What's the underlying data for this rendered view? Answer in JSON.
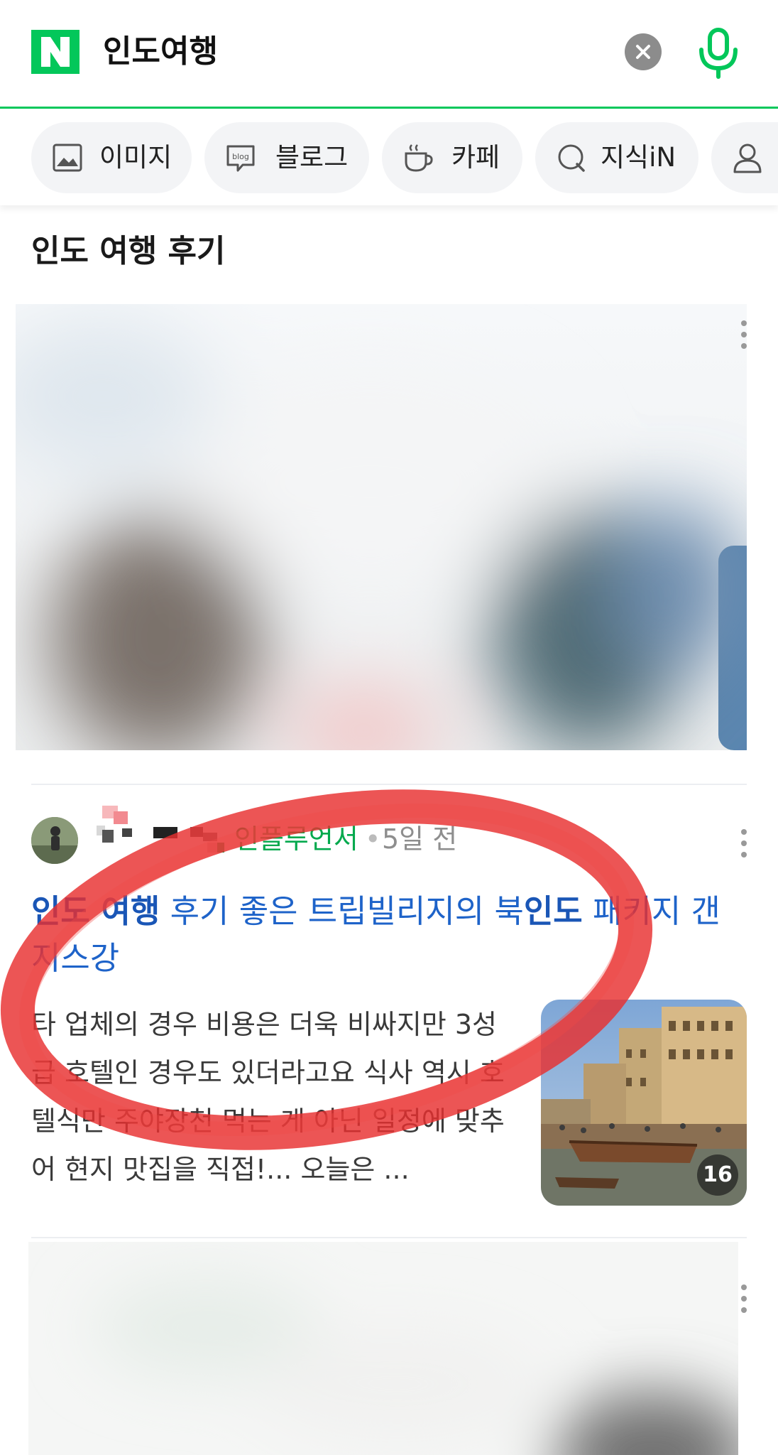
{
  "search": {
    "query": "인도여행"
  },
  "tabs": [
    {
      "label": "이미지",
      "icon": "image-icon"
    },
    {
      "label": "블로그",
      "icon": "blog-icon"
    },
    {
      "label": "카페",
      "icon": "cafe-cup-icon"
    },
    {
      "label": "지식iN",
      "icon": "kin-q-icon"
    },
    {
      "label": "",
      "icon": "person-icon"
    }
  ],
  "section": {
    "title": "인도 여행 후기"
  },
  "post": {
    "author_badge": "인플루언서",
    "separator": "•",
    "time": "5일 전",
    "title_parts": [
      {
        "text": "인도 여행",
        "bold": true
      },
      {
        "text": " 후기 좋은 트립빌리지의 북",
        "bold": false
      },
      {
        "text": "인도",
        "bold": true
      },
      {
        "text": " 패키지 갠지스강",
        "bold": false
      }
    ],
    "excerpt": "타 업체의 경우 비용은 더욱 비싸지만 3성급 호텔인 경우도 있더라고요 식사 역시 호텔식만 주야장천 먹는 게 아닌 일정에 맞추어 현지 맛집을 직접!... 오늘은 ...",
    "thumb_count": "16"
  },
  "colors": {
    "brand_green": "#03c75a",
    "link_blue": "#1e63c9",
    "annotation_red": "#e8302f"
  }
}
